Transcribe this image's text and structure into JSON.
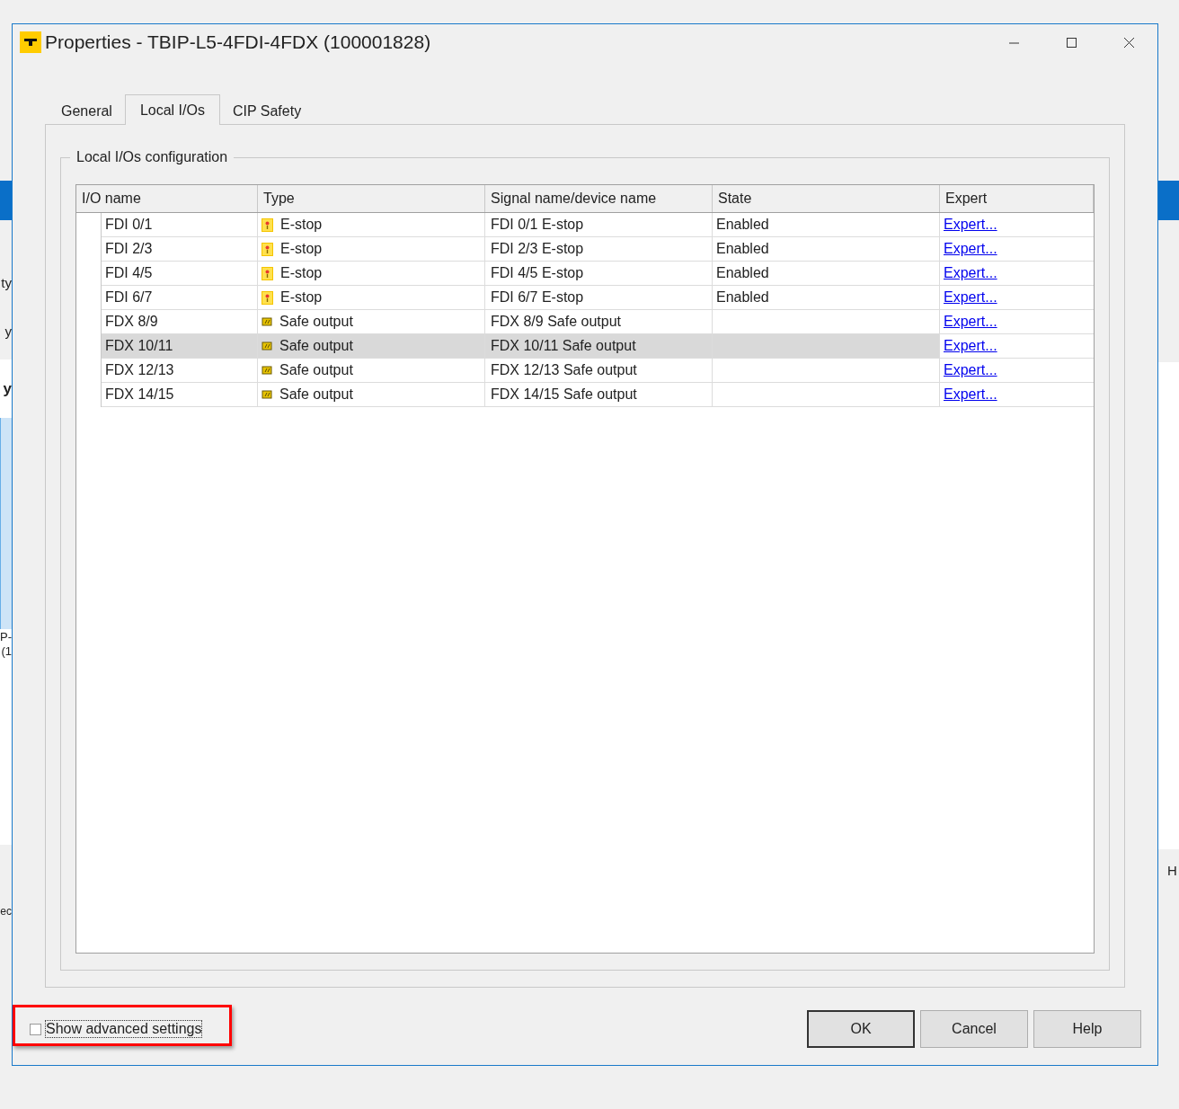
{
  "background_app": {
    "left_fragments": [
      "ty",
      "y",
      "y",
      "P-",
      "(1",
      "ec"
    ],
    "right_fragments": [
      "H"
    ]
  },
  "window": {
    "title": "Properties - TBIP-L5-4FDI-4FDX (100001828)"
  },
  "tabs": [
    {
      "label": "General",
      "selected": false
    },
    {
      "label": "Local I/Os",
      "selected": true
    },
    {
      "label": "CIP Safety",
      "selected": false
    }
  ],
  "group": {
    "title": "Local I/Os configuration"
  },
  "table": {
    "columns": [
      "I/O name",
      "Type",
      "Signal name/device name",
      "State",
      "Expert"
    ],
    "rows": [
      {
        "io_name": "FDI 0/1",
        "kind": "estop",
        "type": "E-stop",
        "signal": "FDI 0/1 E-stop",
        "state": "Enabled",
        "expert": "Expert...",
        "selected": false
      },
      {
        "io_name": "FDI 2/3",
        "kind": "estop",
        "type": "E-stop",
        "signal": "FDI 2/3 E-stop",
        "state": "Enabled",
        "expert": "Expert...",
        "selected": false
      },
      {
        "io_name": "FDI 4/5",
        "kind": "estop",
        "type": "E-stop",
        "signal": "FDI 4/5 E-stop",
        "state": "Enabled",
        "expert": "Expert...",
        "selected": false
      },
      {
        "io_name": "FDI 6/7",
        "kind": "estop",
        "type": "E-stop",
        "signal": "FDI 6/7 E-stop",
        "state": "Enabled",
        "expert": "Expert...",
        "selected": false
      },
      {
        "io_name": "FDX 8/9",
        "kind": "output",
        "type": "Safe output",
        "signal": "FDX 8/9 Safe output",
        "expert": "Expert...",
        "selected": false
      },
      {
        "io_name": "FDX 10/11",
        "kind": "output",
        "type": "Safe output",
        "signal": "FDX 10/11 Safe output",
        "expert": "Expert...",
        "selected": true
      },
      {
        "io_name": "FDX 12/13",
        "kind": "output",
        "type": "Safe output",
        "signal": "FDX 12/13 Safe output",
        "expert": "Expert...",
        "selected": false
      },
      {
        "io_name": "FDX 14/15",
        "kind": "output",
        "type": "Safe output",
        "signal": "FDX 14/15 Safe output",
        "expert": "Expert...",
        "selected": false
      }
    ]
  },
  "advanced_settings": {
    "label": "Show advanced settings",
    "checked": false
  },
  "buttons": [
    "OK",
    "Cancel",
    "Help"
  ]
}
